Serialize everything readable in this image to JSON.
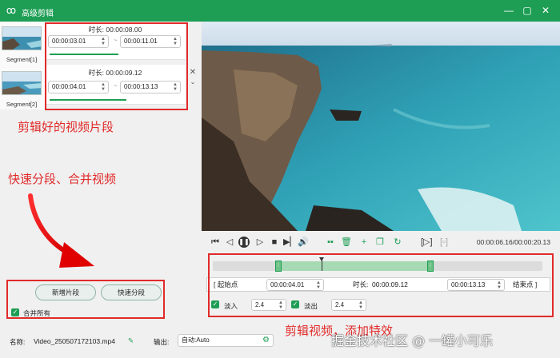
{
  "window": {
    "title": "高级剪辑",
    "accent": "#1e9e55",
    "controls": [
      "minimize-icon",
      "maximize-icon",
      "close-icon"
    ]
  },
  "segments": [
    {
      "thumb_label": "Segment[1]",
      "duration_label": "时长:",
      "duration": "00:00:08.00",
      "start": "00:00:03.01",
      "end": "00:00:11.01"
    },
    {
      "thumb_label": "Segment[2]",
      "duration_label": "时长:",
      "duration": "00:00:09.12",
      "start": "00:00:04.01",
      "end": "00:00:13.13"
    }
  ],
  "annotations": {
    "clips": "剪辑好的视频片段",
    "split_merge": "快速分段、合并视频",
    "effects": "剪辑视频，添加特效",
    "color": "#e12a2a"
  },
  "left_panel": {
    "add_segment": "新增片段",
    "quick_split": "快速分段",
    "merge_all": "合并所有"
  },
  "player": {
    "timecode": "00:00:06.16/00:00:20.13",
    "buttons": [
      "go-start-icon",
      "prev-frame-icon",
      "pause-icon",
      "next-frame-icon",
      "stop-icon",
      "volume-icon",
      "split-icon",
      "delete-icon",
      "add-icon",
      "copy-icon",
      "refresh-icon",
      "mark-in-icon",
      "mark-out-icon"
    ]
  },
  "editor": {
    "start_btn": "[ 起始点",
    "start_value": "00:00:04.01",
    "duration_label": "时长:",
    "duration_value": "00:00:09.12",
    "end_value": "00:00:13.13",
    "end_btn": "结束点 ]",
    "fade_in_label": "淡入",
    "fade_in_value": "2.4",
    "fade_out_label": "淡出",
    "fade_out_value": "2.4"
  },
  "footer": {
    "name_label": "名称:",
    "name_value": "Video_250507172103.mp4",
    "output_label": "输出:",
    "output_value": "自动:Auto",
    "watermark": "掘金技术社区 @ 一罐小可乐"
  }
}
